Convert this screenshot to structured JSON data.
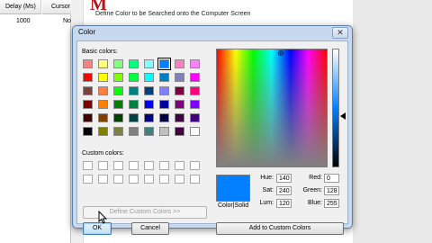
{
  "background": {
    "table_headers": [
      "Delay (Ms)",
      "Cursor B"
    ],
    "row": {
      "delay": "1000",
      "cursor": "No"
    },
    "logo": "M",
    "caption": "Define Color to be Searched onto the Computer Screen"
  },
  "dialog": {
    "title": "Color",
    "close_glyph": "✕",
    "basic_label": "Basic colors:",
    "custom_label": "Custom colors:",
    "basic_colors": [
      [
        "#ff8080",
        "#ffff80",
        "#80ff80",
        "#00ff80",
        "#80ffff",
        "#0080ff",
        "#ff80c0",
        "#ff80ff"
      ],
      [
        "#ff0000",
        "#ffff00",
        "#80ff00",
        "#00ff40",
        "#00ffff",
        "#0080c0",
        "#8080c0",
        "#ff00ff"
      ],
      [
        "#804040",
        "#ff8040",
        "#00ff00",
        "#008080",
        "#004080",
        "#8080ff",
        "#800040",
        "#ff0080"
      ],
      [
        "#800000",
        "#ff8000",
        "#008000",
        "#008040",
        "#0000ff",
        "#0000a0",
        "#800080",
        "#8000ff"
      ],
      [
        "#400000",
        "#804000",
        "#004000",
        "#004040",
        "#000080",
        "#000040",
        "#400040",
        "#400080"
      ],
      [
        "#000000",
        "#808000",
        "#808040",
        "#808080",
        "#408080",
        "#c0c0c0",
        "#400040",
        "#ffffff"
      ]
    ],
    "selected_basic": {
      "row": 0,
      "col": 5
    },
    "define_custom_button": "Define Custom Colors >>",
    "ok_button": "OK",
    "cancel_button": "Cancel",
    "add_custom_button": "Add to Custom Colors",
    "preview_label": "Color|Solid",
    "current_color": "#0080ff",
    "fields": {
      "hue": {
        "label": "Hue:",
        "value": "140"
      },
      "sat": {
        "label": "Sat:",
        "value": "240"
      },
      "lum": {
        "label": "Lum:",
        "value": "120"
      },
      "red": {
        "label": "Red:",
        "value": "0"
      },
      "green": {
        "label": "Green:",
        "value": "128"
      },
      "blue": {
        "label": "Blue:",
        "value": "255"
      }
    },
    "crosshair_glyph": "⊕",
    "cursor_icon": "mouse-pointer-icon"
  }
}
